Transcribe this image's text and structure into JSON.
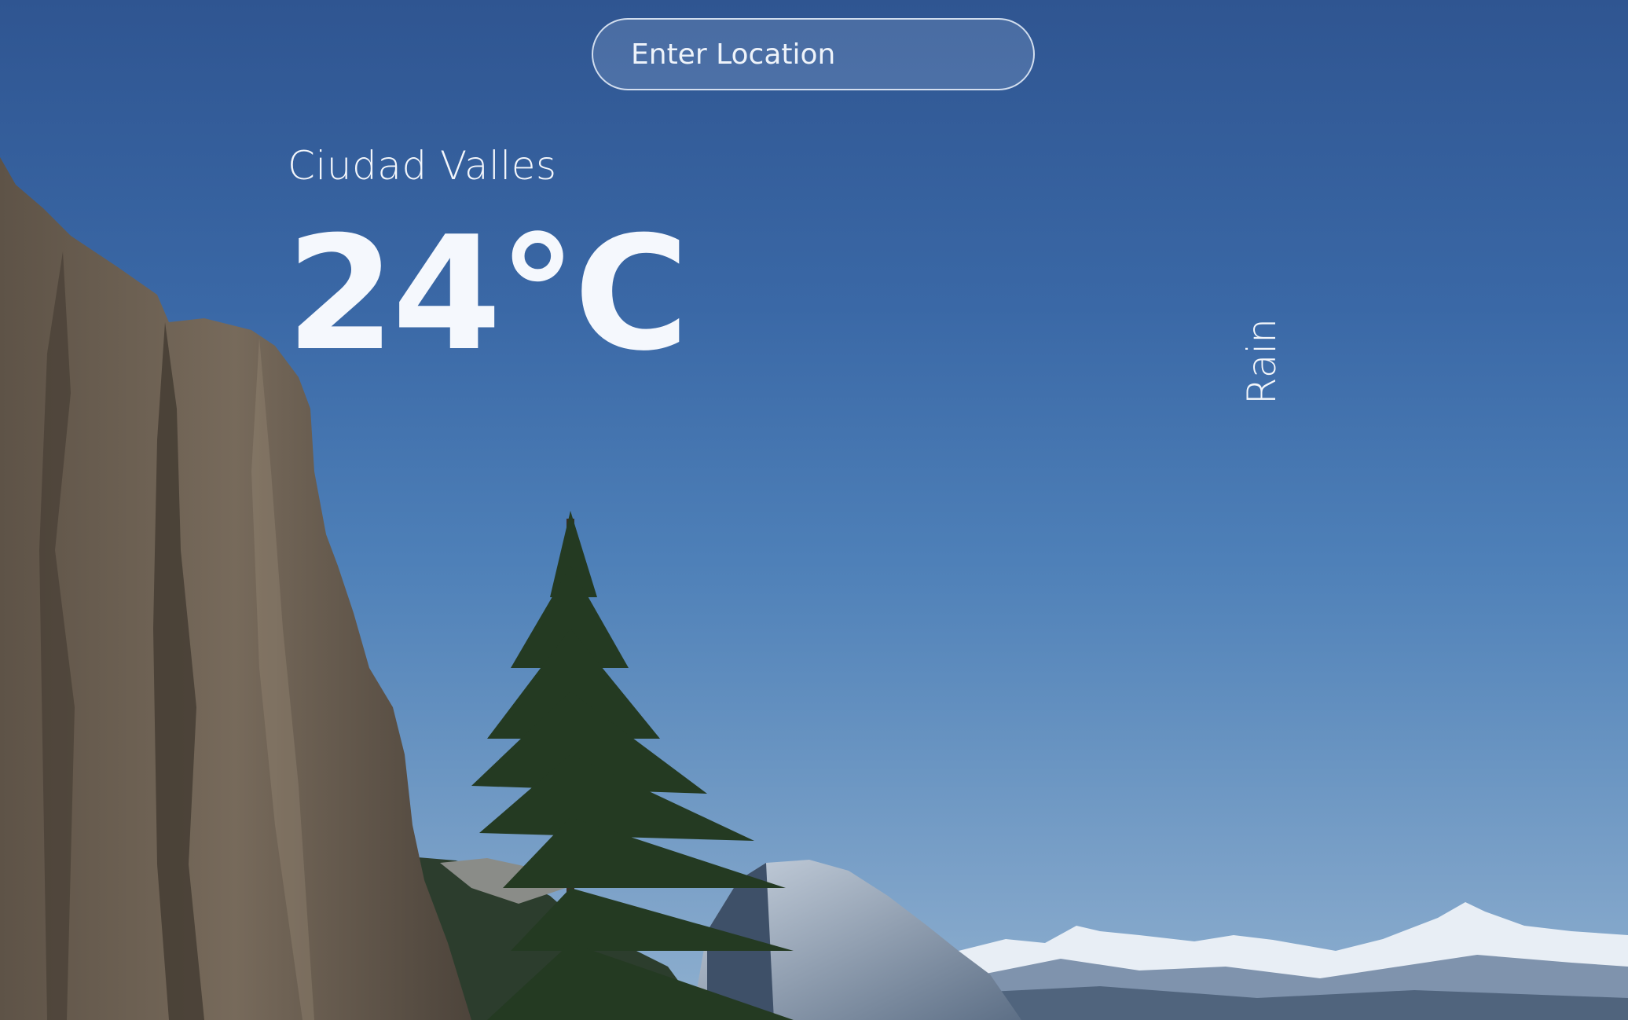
{
  "search": {
    "placeholder": "Enter Location",
    "value": ""
  },
  "weather": {
    "city": "Ciudad Valles",
    "temperature": "24°C",
    "condition": "Rain"
  },
  "background": {
    "scene": "mountain valley with granite cliff, pine tree and snowy peaks under blue sky"
  },
  "colors": {
    "sky_top": "#2f5591",
    "sky_bottom": "#8fb0cf",
    "text": "#f3f6fb"
  }
}
